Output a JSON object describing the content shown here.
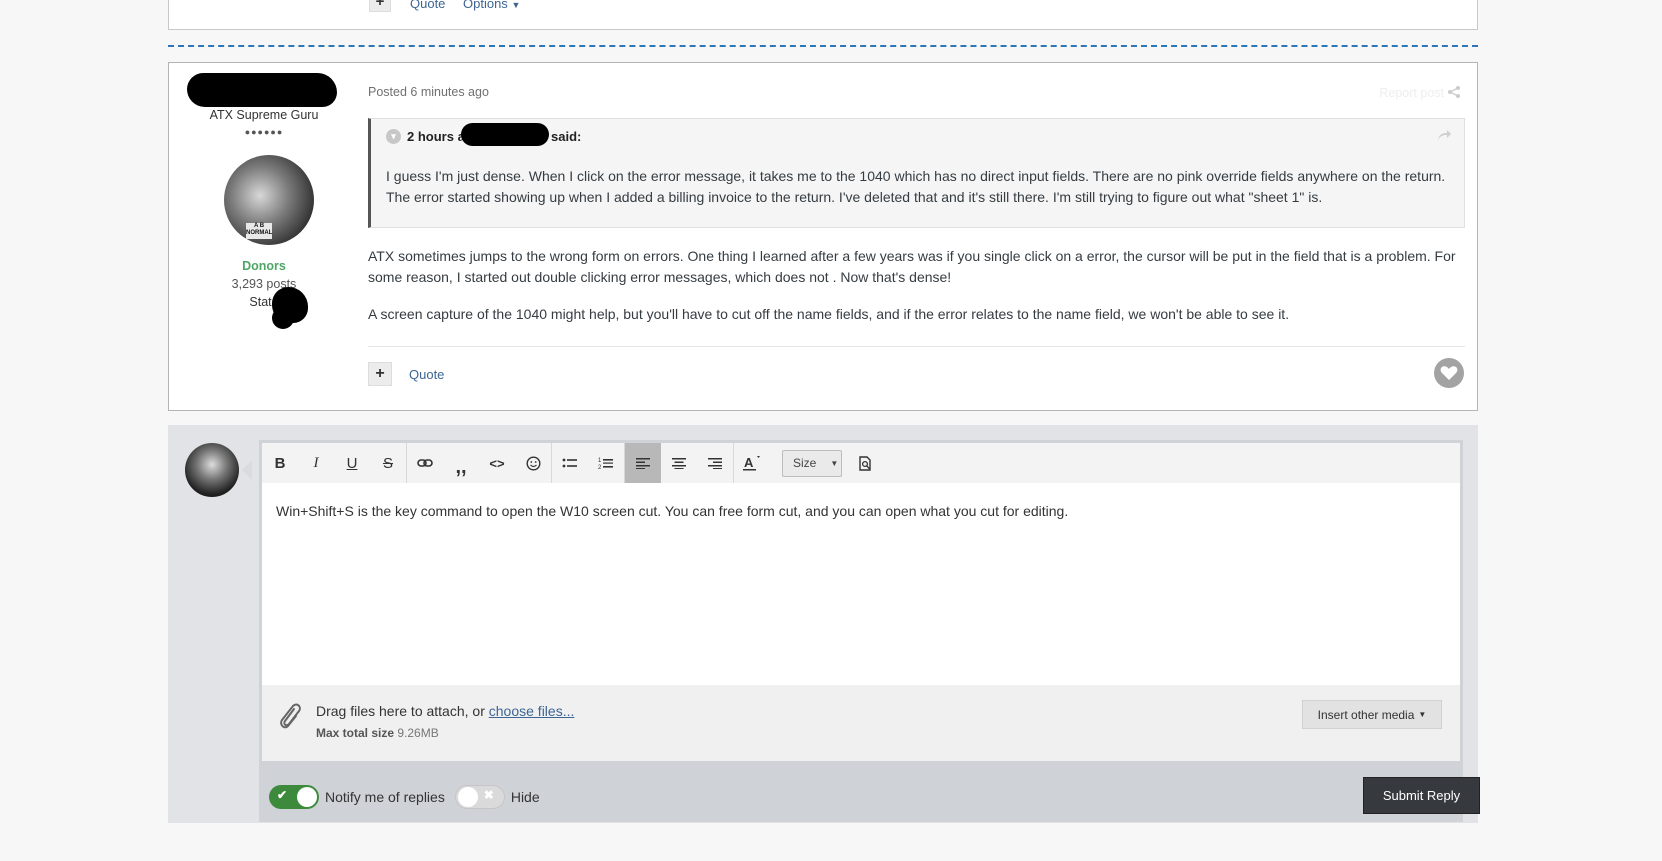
{
  "prev_post": {
    "quote_label": "Quote",
    "options_label": "Options",
    "add_label": "+"
  },
  "post": {
    "author": {
      "rank": "ATX Supreme Guru",
      "rank_pips": "●●●●●●",
      "avatar_sign": "A B\nNORMAL",
      "group": "Donors",
      "posts": "3,293 posts",
      "state": "State"
    },
    "meta": "Posted 6 minutes ago",
    "report_label": "Report post",
    "quote_block": {
      "header_prefix": "2 hours ag",
      "header_suffix": "said:",
      "text": "I guess I'm just dense. When I click on the error message, it takes me to the 1040 which has no direct input fields. There are no pink override  fields anywhere on the return. The error started showing up when I added a billing invoice to the return. I've deleted that and it's still there. I'm still trying to figure out what \"sheet 1\" is."
    },
    "paragraph1": "ATX sometimes jumps to the wrong form on errors. One thing I learned after a few years was if you single click on a error, the cursor will be put in the field that is a problem. For some reason, I started out double clicking error messages, which does not . Now that's dense!",
    "paragraph2": "A screen capture of the 1040 might help, but you'll have to cut off the name fields, and if the error relates to the name field, we won't be able to see it.",
    "add_label": "+",
    "quote_label": "Quote"
  },
  "editor": {
    "toolbar": {
      "bold": "B",
      "italic": "I",
      "underline": "U",
      "strike": "S",
      "size_label": "Size"
    },
    "content": "Win+Shift+S is the key command to open the W10 screen cut.  You can free form cut, and you can open what you cut for editing.",
    "attach": {
      "drag_text": "Drag files here to attach, or ",
      "choose_link": "choose files...",
      "max_label": "Max total size",
      "max_value": "9.26MB",
      "insert_media": "Insert other media"
    },
    "notify_label": "Notify me of replies",
    "hide_label": "Hide",
    "submit_label": "Submit Reply"
  },
  "colors": {
    "link": "#3d6594",
    "group": "#4ea766",
    "toggle_on": "#3d8a3d",
    "submit_bg": "#36393e",
    "separator": "#2d77b7"
  },
  "icons": [
    "share-icon",
    "arrow-icon",
    "heart-icon",
    "link-icon",
    "quote-icon",
    "code-icon",
    "emoji-icon",
    "bullet-list-icon",
    "numbered-list-icon",
    "align-left-icon",
    "align-center-icon",
    "align-right-icon",
    "text-color-icon",
    "preview-icon",
    "paperclip-icon",
    "chevron-down-icon",
    "check-icon",
    "x-icon"
  ]
}
